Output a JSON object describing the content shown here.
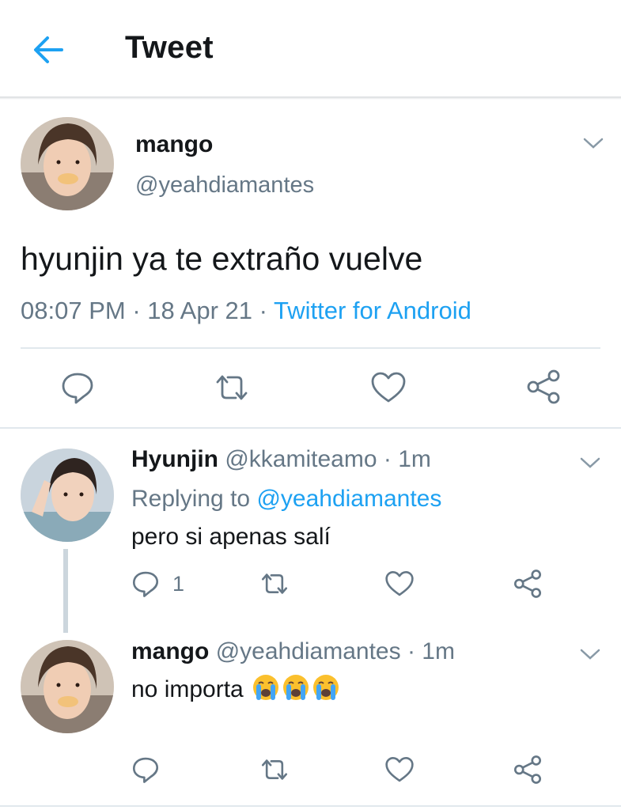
{
  "header": {
    "title": "Tweet",
    "back_icon": "arrow-left-icon"
  },
  "colors": {
    "accent": "#1da1f2",
    "secondary_text": "#657786",
    "icon": "#657786",
    "divider": "#e1e8ed"
  },
  "main_tweet": {
    "display_name": "mango",
    "handle": "@yeahdiamantes",
    "text": "hyunjin ya te extraño vuelve",
    "time": "08:07 PM",
    "separator": " · ",
    "date": "18 Apr 21",
    "source": "Twitter for Android"
  },
  "replies": [
    {
      "display_name": "Hyunjin",
      "handle": "@kkamiteamo",
      "time": "· 1m",
      "replying_label": "Replying to",
      "replying_to": "@yeahdiamantes",
      "text": "pero si apenas salí",
      "reply_count": "1"
    },
    {
      "display_name": "mango",
      "handle": "@yeahdiamantes",
      "time": "· 1m",
      "text": "no importa",
      "emoji": [
        "loudly-crying-face",
        "loudly-crying-face",
        "loudly-crying-face"
      ]
    }
  ]
}
